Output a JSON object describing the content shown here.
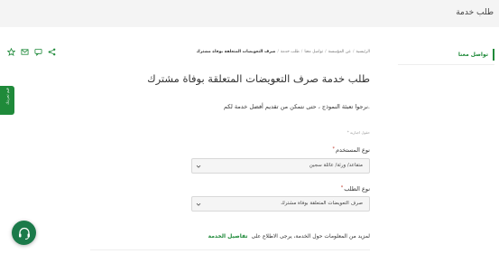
{
  "header": {
    "title": "طلب خدمة"
  },
  "breadcrumb": {
    "items": [
      "الرئيسية",
      "عن المؤسسة",
      "تواصل معنا",
      "طلب خدمة"
    ],
    "current": "صرف التعويضات المتعلقة بوفاة مشترك"
  },
  "sidebar": {
    "contact_label": "تواصل معنا"
  },
  "side_tab": {
    "label": "قيم تجربتك"
  },
  "main": {
    "title": "طلب خدمة  صرف التعويضات المتعلقة بوفاة مشترك",
    "lead": "نرجوا تعبئة النموذج ، حتى نتمكن من تقديم أفضل خدمة لكم.",
    "required_note": "* حقول اجبارية",
    "user_type": {
      "label": "نوع المستخدم",
      "value": "متقاعد/ ورثة/ عائلة سجين"
    },
    "request_type": {
      "label": "نوع الطلب",
      "value": "صرف التعويضات المتعلقة بوفاة مشترك"
    },
    "more_info": {
      "text": "لمزيد من المعلومات حول الخدمة، يرجى الاطلاع على",
      "link": "تفاصيل الخدمة"
    }
  },
  "tools": [
    "share-icon",
    "chat-icon",
    "email-icon",
    "star-icon"
  ],
  "colors": {
    "accent": "#1f8a3a",
    "fab": "#1b7a4a"
  }
}
